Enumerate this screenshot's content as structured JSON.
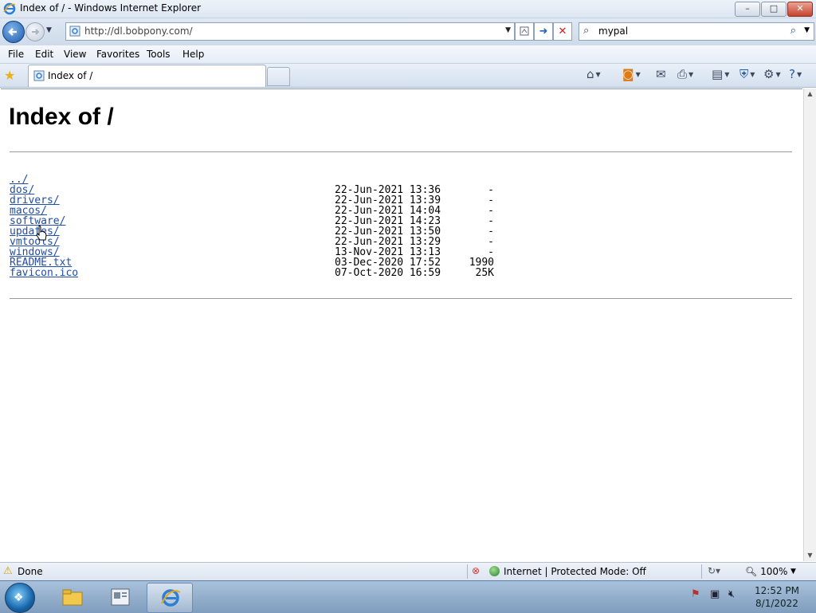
{
  "window": {
    "title": "Index of / - Windows Internet Explorer",
    "controls": {
      "minimize": "–",
      "maximize": "□",
      "close": "✕"
    }
  },
  "address_bar": {
    "url": "http://dl.bobpony.com/",
    "search_value": "mypal"
  },
  "menu": [
    "File",
    "Edit",
    "View",
    "Favorites",
    "Tools",
    "Help"
  ],
  "tab": {
    "label": "Index of /"
  },
  "page": {
    "heading": "Index of /",
    "entries": [
      {
        "name": "../",
        "date": "",
        "size": ""
      },
      {
        "name": "dos/",
        "date": "22-Jun-2021 13:36",
        "size": "-"
      },
      {
        "name": "drivers/",
        "date": "22-Jun-2021 13:39",
        "size": "-"
      },
      {
        "name": "macos/",
        "date": "22-Jun-2021 14:04",
        "size": "-"
      },
      {
        "name": "software/",
        "date": "22-Jun-2021 14:23",
        "size": "-"
      },
      {
        "name": "updates/",
        "date": "22-Jun-2021 13:50",
        "size": "-"
      },
      {
        "name": "vmtools/",
        "date": "22-Jun-2021 13:29",
        "size": "-"
      },
      {
        "name": "windows/",
        "date": "13-Nov-2021 13:13",
        "size": "-"
      },
      {
        "name": "README.txt",
        "date": "03-Dec-2020 17:52",
        "size": "1990"
      },
      {
        "name": "favicon.ico",
        "date": "07-Oct-2020 16:59",
        "size": "25K"
      }
    ]
  },
  "status_bar": {
    "status": "Done",
    "zone": "Internet | Protected Mode: Off",
    "zoom": "100%"
  },
  "taskbar": {
    "time": "12:52 PM",
    "date": "8/1/2022"
  },
  "colors": {
    "link": "#1f4ca8",
    "accent": "#1e5aa8"
  }
}
